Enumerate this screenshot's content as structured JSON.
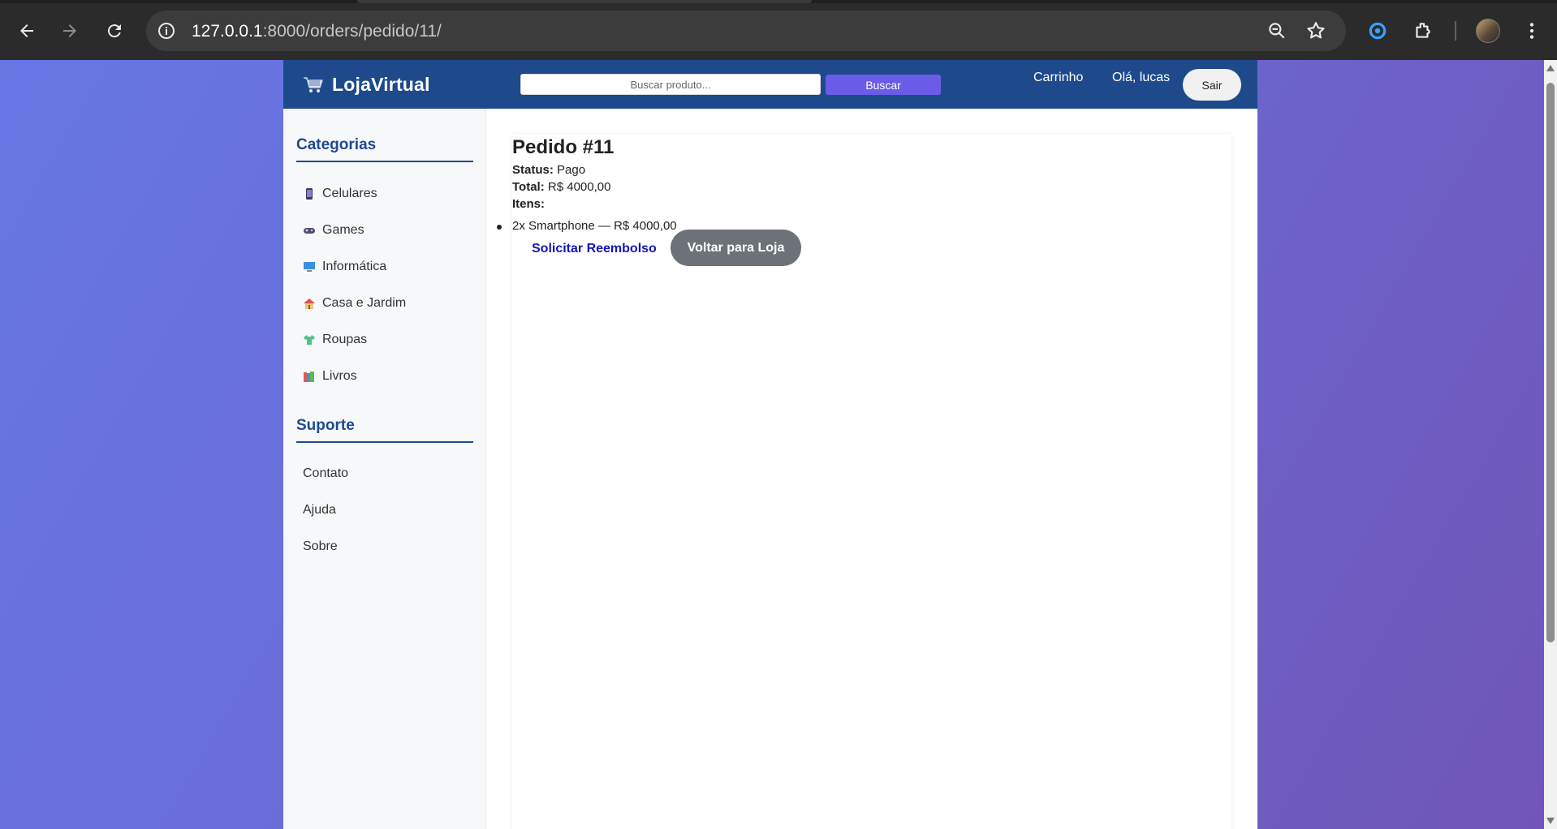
{
  "browser": {
    "url_host": "127.0.0.1",
    "url_rest": ":8000/orders/pedido/11/"
  },
  "header": {
    "brand": "LojaVirtual",
    "search_placeholder": "Buscar produto...",
    "search_button": "Buscar",
    "cart_link": "Carrinho",
    "greeting": "Olá, lucas",
    "logout": "Sair"
  },
  "sidebar": {
    "categories_title": "Categorias",
    "categories": [
      {
        "label": "Celulares",
        "icon": "phone-icon"
      },
      {
        "label": "Games",
        "icon": "gamepad-icon"
      },
      {
        "label": "Informática",
        "icon": "computer-icon"
      },
      {
        "label": "Casa e Jardim",
        "icon": "house-icon"
      },
      {
        "label": "Roupas",
        "icon": "shirt-icon"
      },
      {
        "label": "Livros",
        "icon": "books-icon"
      }
    ],
    "support_title": "Suporte",
    "support_links": [
      {
        "label": "Contato"
      },
      {
        "label": "Ajuda"
      },
      {
        "label": "Sobre"
      }
    ]
  },
  "order": {
    "title": "Pedido #11",
    "status_label": "Status:",
    "status_value": "Pago",
    "total_label": "Total:",
    "total_value": "R$ 4000,00",
    "items_label": "Itens:",
    "items": [
      "2x Smartphone — R$ 4000,00"
    ],
    "refund_link": "Solicitar Reembolso",
    "back_button": "Voltar para Loja"
  },
  "colors": {
    "header_bg": "#1e4a8c",
    "search_button_bg": "#6b5ce7",
    "back_button_bg": "#6c7278",
    "link_color": "#1515b8"
  }
}
